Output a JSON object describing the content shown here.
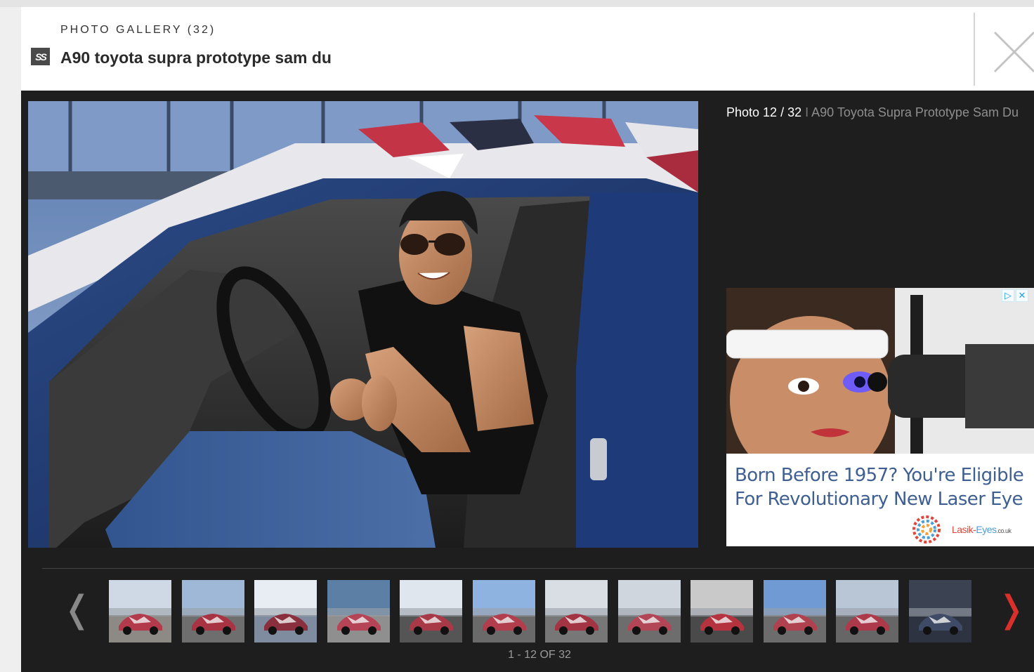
{
  "gallery": {
    "label": "PHOTO GALLERY (32)",
    "title": "A90 toyota supra prototype sam du",
    "brand_icon": "SS"
  },
  "caption": {
    "count": "Photo 12 / 32",
    "separator": "I",
    "text": "A90 Toyota Supra Prototype Sam Du"
  },
  "ad": {
    "headline": "Born Before 1957? You're Eligible For Revolutionary New Laser Eye",
    "brand_lasik": "Lasik-",
    "brand_eyes": "Eyes",
    "brand_tld": ".co.uk",
    "choices": [
      "▷",
      "✕"
    ]
  },
  "nav": {
    "prev": "❬",
    "next": "❭",
    "pager": "1 - 12 OF 32"
  },
  "thumbnails": [
    {
      "name": "thumb-1",
      "sky": "#cfd9e6",
      "ground": "#8d8a85",
      "car": "#b33a4a"
    },
    {
      "name": "thumb-2",
      "sky": "#9fb8d8",
      "ground": "#6e6e6e",
      "car": "#a83343"
    },
    {
      "name": "thumb-3",
      "sky": "#e8edf3",
      "ground": "#7f8ca0",
      "car": "#8a2f3d"
    },
    {
      "name": "thumb-4",
      "sky": "#5c7fa6",
      "ground": "#8f8f8f",
      "car": "#b54556"
    },
    {
      "name": "thumb-5",
      "sky": "#dfe6ee",
      "ground": "#555",
      "car": "#a83a48"
    },
    {
      "name": "thumb-6",
      "sky": "#8eb3e0",
      "ground": "#6a6a6a",
      "car": "#b13d4d"
    },
    {
      "name": "thumb-7",
      "sky": "#d9dee5",
      "ground": "#777",
      "car": "#a23444"
    },
    {
      "name": "thumb-8",
      "sky": "#cfd6dd",
      "ground": "#6d6d6d",
      "car": "#b24556"
    },
    {
      "name": "thumb-9",
      "sky": "#c9c9c9",
      "ground": "#4a4a4a",
      "car": "#b5323f"
    },
    {
      "name": "thumb-10",
      "sky": "#6f9ad4",
      "ground": "#6c6c6c",
      "car": "#b0414f"
    },
    {
      "name": "thumb-11",
      "sky": "#b9c6d6",
      "ground": "#666",
      "car": "#ad3a4a"
    },
    {
      "name": "thumb-12",
      "sky": "#3b4353",
      "ground": "#2d3340",
      "car": "#3f4a66"
    }
  ],
  "colors": {
    "modal_bg": "#1e1e1e",
    "accent_next": "#d9302b",
    "ad_headline": "#3f5f93"
  }
}
